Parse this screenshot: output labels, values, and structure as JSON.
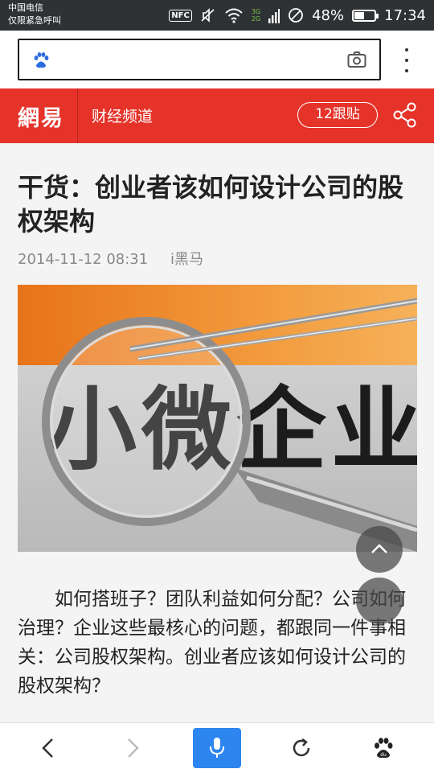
{
  "status_bar": {
    "carrier": "中国电信",
    "emergency": "仅限紧急呼叫",
    "nfc_label": "NFC",
    "network_top": "3G",
    "network_bottom": "2G",
    "battery": "48%",
    "battery_level": 0.48,
    "time": "17:34"
  },
  "header": {
    "logo": "網易",
    "channel": "财经频道",
    "follow_label": "12跟贴"
  },
  "article": {
    "title": "干货：创业者该如何设计公司的股权架构",
    "date": "2014-11-12 08:31",
    "author": "i黑马",
    "image_text": "小微企业",
    "body": "如何搭班子？团队利益如何分配？公司如何治理？企业这些最核心的问题，都跟同一件事相关：公司股权架构。创业者应该如何设计公司的股权架构？"
  },
  "colors": {
    "brand_red": "#e5332a",
    "accent_blue": "#2d86f0",
    "status_bar": "#2f3234"
  },
  "icons": [
    "baidu-paw-icon",
    "camera-icon",
    "more-vert-icon",
    "share-icon",
    "scroll-up-icon",
    "back-icon",
    "forward-icon",
    "mic-icon",
    "refresh-icon"
  ]
}
